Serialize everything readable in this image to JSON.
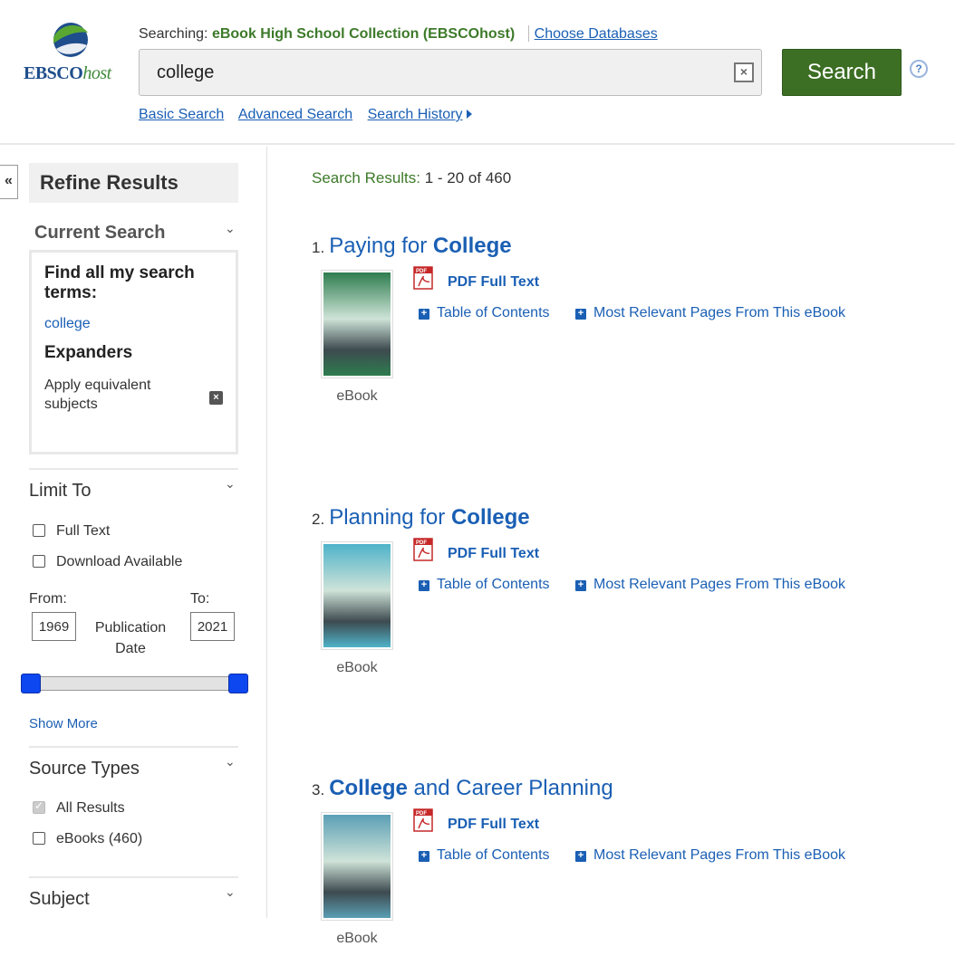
{
  "header": {
    "logo_main": "EBSCO",
    "logo_host": "host",
    "searching_label": "Searching:",
    "database": "eBook High School Collection (EBSCOhost)",
    "choose_databases": "Choose Databases",
    "search_value": "college",
    "search_button": "Search",
    "help": "?",
    "links": [
      "Basic Search",
      "Advanced Search",
      "Search History"
    ]
  },
  "sidebar": {
    "collapse": "«",
    "refine_title": "Refine Results",
    "current_search_title": "Current Search",
    "find_all_label": "Find all my search terms:",
    "search_term": "college",
    "expanders_title": "Expanders",
    "expander_item": "Apply equivalent subjects",
    "limit_to_title": "Limit To",
    "limit_options": [
      "Full Text",
      "Download Available"
    ],
    "from_label": "From:",
    "to_label": "To:",
    "from_year": "1969",
    "to_year": "2021",
    "pub_date_label": "Publication Date",
    "show_more": "Show More",
    "source_types_title": "Source Types",
    "source_all": "All Results",
    "source_ebooks": "eBooks (460)",
    "subject_title": "Subject"
  },
  "results": {
    "label": "Search Results:",
    "range": "1 - 20 of 460",
    "items": [
      {
        "num": "1.",
        "pre": "Paying for ",
        "hl": "College",
        "post": "",
        "type": "eBook",
        "pdf": "PDF Full Text",
        "toc": "Table of Contents",
        "relevant": "Most Relevant Pages From This eBook",
        "cover_color": "#2e7d4f"
      },
      {
        "num": "2.",
        "pre": "Planning for ",
        "hl": "College",
        "post": "",
        "type": "eBook",
        "pdf": "PDF Full Text",
        "toc": "Table of Contents",
        "relevant": "Most Relevant Pages From This eBook",
        "cover_color": "#4fb3c9"
      },
      {
        "num": "3.",
        "pre": "",
        "hl": "College",
        "post": " and Career Planning",
        "type": "eBook",
        "pdf": "PDF Full Text",
        "toc": "Table of Contents",
        "relevant": "Most Relevant Pages From This eBook",
        "cover_color": "#5b9fb5"
      }
    ]
  },
  "colors": {
    "accent_green": "#3c6e24",
    "link_blue": "#1a5fb4",
    "slider_blue": "#0d47f0"
  }
}
